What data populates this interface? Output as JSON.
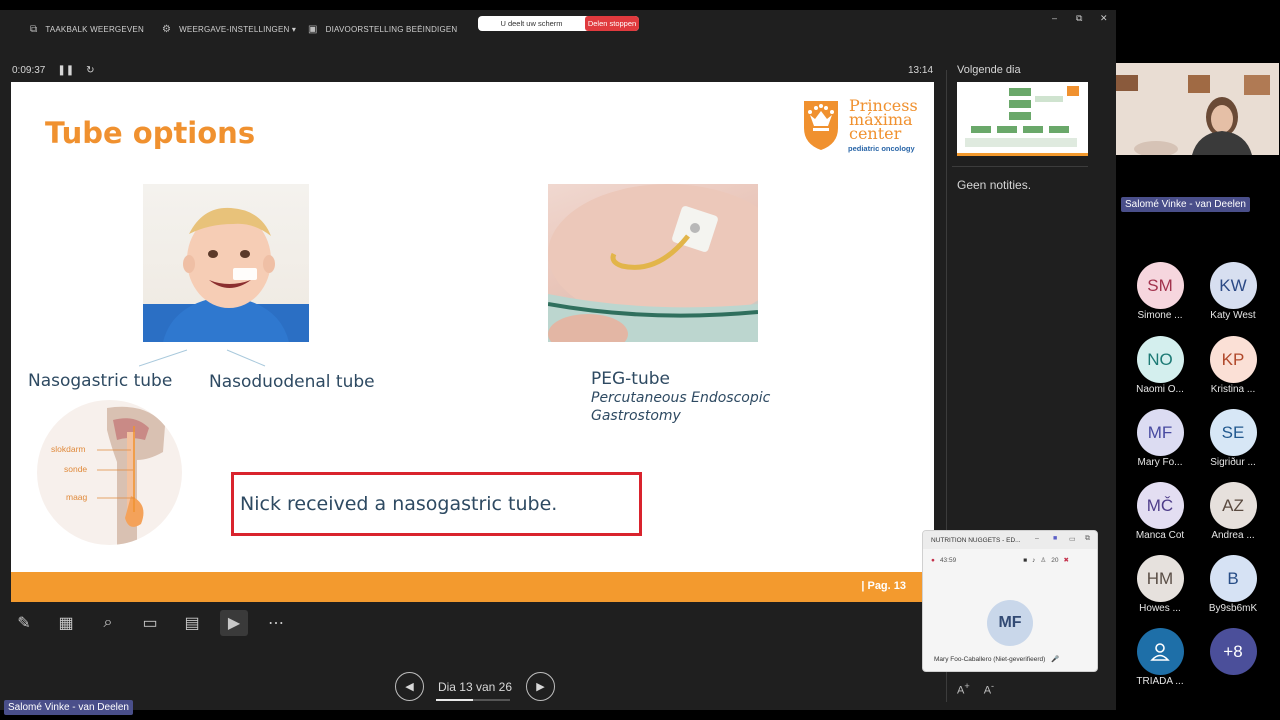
{
  "toolbar": {
    "taskbar": "TAAKBALK WEERGEVEN",
    "display_settings": "WEERGAVE-INSTELLINGEN ▾",
    "end_slideshow": "DIAVOORSTELLING BEËINDIGEN",
    "sharing_text": "U deelt uw scherm",
    "stop_sharing": "Delen stoppen"
  },
  "timer": {
    "elapsed": "0:09:37",
    "clock": "13:14"
  },
  "slide": {
    "title": "Tube options",
    "logo_line1": "Princess",
    "logo_line2": "máxima",
    "logo_line3": "center",
    "logo_sub": "pediatric oncology",
    "label_nasogastric": "Nasogastric tube",
    "label_nasoduodenal": "Nasoduodenal tube",
    "label_peg": "PEG-tube",
    "label_peg_full_1": "Percutaneous Endoscopic",
    "label_peg_full_2": "Gastrostomy",
    "anatomy_labels": [
      "slokdarm",
      "sonde",
      "maag"
    ],
    "callout": "Nick received a nasogastric tube.",
    "page": "|  Pag. 13"
  },
  "navigation": {
    "slide_counter": "Dia 13 van 26",
    "progress": 0.5
  },
  "side_panel": {
    "next_label": "Volgende dia",
    "notes": "Geen notities."
  },
  "teams_popup": {
    "title": "NUTRITION NUGGETS - ED...",
    "duration": "43:59",
    "participants": "20",
    "avatar_initials": "MF",
    "name": "Mary Foo-Caballero (Niet-geverifieerd)"
  },
  "presenter_tag": "Salomé Vinke - van Deelen",
  "video_name": "Salomé Vinke - van Deelen",
  "participants": [
    {
      "initials": "SM",
      "name": "Simone ...",
      "bg": "#f6d6de",
      "fg": "#a2324d"
    },
    {
      "initials": "KW",
      "name": "Katy West",
      "bg": "#d7dff0",
      "fg": "#2c4a86"
    },
    {
      "initials": "NO",
      "name": "Naomi O...",
      "bg": "#d4efee",
      "fg": "#1d7a75"
    },
    {
      "initials": "KP",
      "name": "Kristina ...",
      "bg": "#fbe0d6",
      "fg": "#b1482a"
    },
    {
      "initials": "MF",
      "name": "Mary Fo...",
      "bg": "#dcdcf2",
      "fg": "#474aa0"
    },
    {
      "initials": "SE",
      "name": "Sigriður ...",
      "bg": "#d7e7f6",
      "fg": "#22598f"
    },
    {
      "initials": "MČ",
      "name": "Manca Cot",
      "bg": "#e3def2",
      "fg": "#4e3d8a"
    },
    {
      "initials": "AZ",
      "name": "Andrea ...",
      "bg": "#e6e0dc",
      "fg": "#5a4a40"
    },
    {
      "initials": "HM",
      "name": "Howes ...",
      "bg": "#e6e1dd",
      "fg": "#5a4e46"
    },
    {
      "initials": "B",
      "name": "By9sb6mK",
      "bg": "#d6e2f4",
      "fg": "#274d86"
    },
    {
      "initials": "",
      "name": "TRIADA ...",
      "bg": "#1e6fa8",
      "fg": "#ffffff"
    },
    {
      "initials": "+8",
      "name": "",
      "bg": "#4b4f9a",
      "fg": "#ffffff"
    }
  ],
  "colors": {
    "accent": "#f39a2e",
    "callout_border": "#d9232d",
    "title": "#f0912f"
  }
}
